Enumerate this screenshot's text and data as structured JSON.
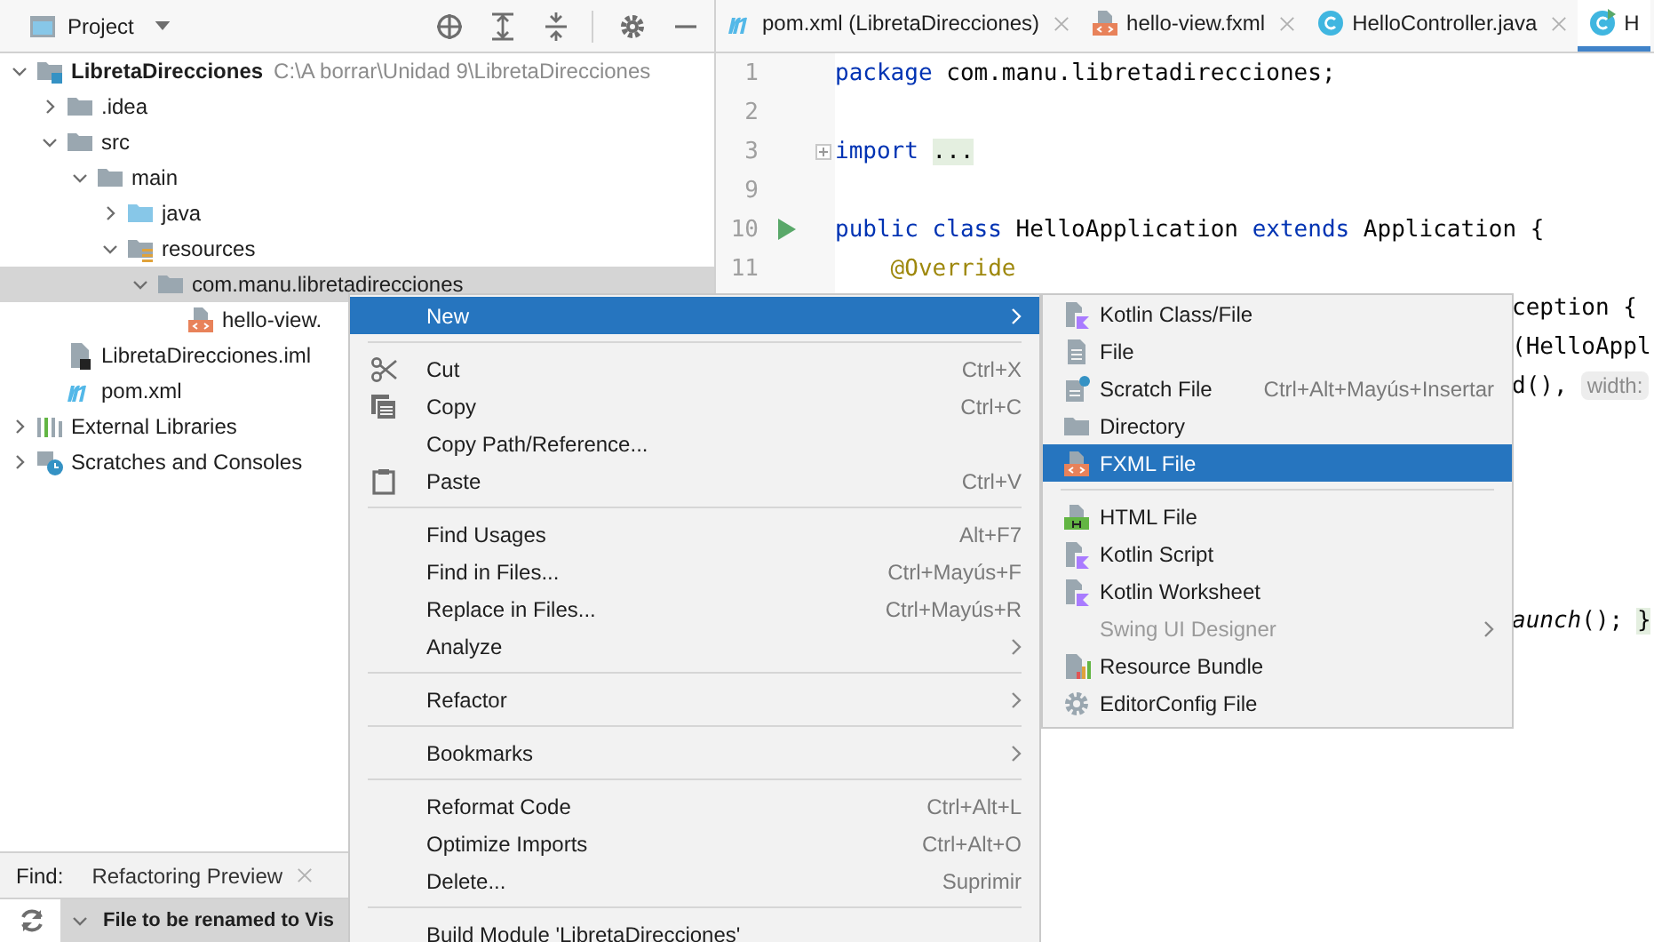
{
  "project_panel": {
    "title": "Project",
    "tree": [
      {
        "label": "LibretaDirecciones",
        "hint": "C:\\A borrar\\Unidad 9\\LibretaDirecciones",
        "kind": "module",
        "expanded": true,
        "selected": false,
        "children": [
          {
            "label": ".idea",
            "kind": "folder",
            "expanded": false,
            "selected": false
          },
          {
            "label": "src",
            "kind": "folder",
            "expanded": true,
            "selected": false,
            "children": [
              {
                "label": "main",
                "kind": "folder",
                "expanded": true,
                "selected": false,
                "children": [
                  {
                    "label": "java",
                    "kind": "source-folder",
                    "expanded": false,
                    "selected": false
                  },
                  {
                    "label": "resources",
                    "kind": "resources-folder",
                    "expanded": true,
                    "selected": false,
                    "children": [
                      {
                        "label": "com.manu.libretadirecciones",
                        "kind": "package",
                        "expanded": true,
                        "selected": true,
                        "children": [
                          {
                            "label": "hello-view.",
                            "kind": "fxml",
                            "selected": false
                          }
                        ]
                      }
                    ]
                  }
                ]
              }
            ]
          },
          {
            "label": "LibretaDirecciones.iml",
            "kind": "iml",
            "selected": false
          },
          {
            "label": "pom.xml",
            "kind": "maven",
            "selected": false
          }
        ]
      },
      {
        "label": "External Libraries",
        "kind": "libraries",
        "expanded": false,
        "selected": false
      },
      {
        "label": "Scratches and Consoles",
        "kind": "scratches",
        "expanded": false,
        "selected": false
      }
    ]
  },
  "find_panel": {
    "label": "Find:",
    "tab": "Refactoring Preview",
    "row": "File to be renamed to Vis"
  },
  "editor": {
    "tabs": [
      {
        "label": "pom.xml (LibretaDirecciones)",
        "kind": "maven",
        "selected": false
      },
      {
        "label": "hello-view.fxml",
        "kind": "fxml",
        "selected": false
      },
      {
        "label": "HelloController.java",
        "kind": "class",
        "selected": false
      },
      {
        "label": "H",
        "kind": "app-class",
        "selected": true
      }
    ],
    "lines": [
      {
        "number": "1",
        "tokens": [
          {
            "text": "package",
            "kind": "keyword"
          },
          {
            "text": " com.manu.libretadirecciones;",
            "kind": "plain"
          }
        ]
      },
      {
        "number": "2"
      },
      {
        "number": "3",
        "fold": true,
        "tokens": [
          {
            "text": "import",
            "kind": "keyword"
          },
          {
            "text": "...",
            "kind": "folded"
          }
        ]
      },
      {
        "number": "9"
      },
      {
        "number": "10",
        "run": true,
        "tokens": [
          {
            "text": "public class",
            "kind": "keyword"
          },
          {
            "text": " HelloApplication ",
            "kind": "plain"
          },
          {
            "text": "extends",
            "kind": "keyword"
          },
          {
            "text": " Application {",
            "kind": "plain"
          }
        ]
      },
      {
        "number": "11",
        "tokens": [
          {
            "text": "    @Override",
            "kind": "annotation"
          }
        ]
      }
    ],
    "fragments": [
      {
        "tokens": [
          {
            "text": "ception {",
            "kind": "plain"
          }
        ]
      },
      {
        "tokens": [
          {
            "text": "(HelloAppl",
            "kind": "plain"
          }
        ]
      },
      {
        "tokens": [
          {
            "text": "d(),",
            "kind": "plain"
          },
          {
            "text": "width:",
            "kind": "hint"
          }
        ]
      },
      {
        "tokens": [
          {
            "text": "aunch",
            "kind": "italic"
          },
          {
            "text": "(); ",
            "kind": "plain"
          },
          {
            "text": "}",
            "kind": "folded"
          }
        ]
      }
    ]
  },
  "context_menu": {
    "items": [
      {
        "kind": "action",
        "label": "New",
        "submenu": true,
        "selected": true
      },
      {
        "kind": "separator"
      },
      {
        "kind": "action",
        "label": "Cut",
        "shortcut": "Ctrl+X",
        "selected": false
      },
      {
        "kind": "action",
        "label": "Copy",
        "shortcut": "Ctrl+C",
        "selected": false
      },
      {
        "kind": "action",
        "label": "Copy Path/Reference...",
        "selected": false
      },
      {
        "kind": "action",
        "label": "Paste",
        "shortcut": "Ctrl+V",
        "selected": false
      },
      {
        "kind": "separator"
      },
      {
        "kind": "action",
        "label": "Find Usages",
        "shortcut": "Alt+F7",
        "selected": false
      },
      {
        "kind": "action",
        "label": "Find in Files...",
        "shortcut": "Ctrl+Mayús+F",
        "selected": false
      },
      {
        "kind": "action",
        "label": "Replace in Files...",
        "shortcut": "Ctrl+Mayús+R",
        "selected": false
      },
      {
        "kind": "action",
        "label": "Analyze",
        "submenu": true,
        "selected": false
      },
      {
        "kind": "separator"
      },
      {
        "kind": "action",
        "label": "Refactor",
        "submenu": true,
        "selected": false
      },
      {
        "kind": "separator"
      },
      {
        "kind": "action",
        "label": "Bookmarks",
        "submenu": true,
        "selected": false
      },
      {
        "kind": "separator"
      },
      {
        "kind": "action",
        "label": "Reformat Code",
        "shortcut": "Ctrl+Alt+L",
        "selected": false
      },
      {
        "kind": "action",
        "label": "Optimize Imports",
        "shortcut": "Ctrl+Alt+O",
        "selected": false
      },
      {
        "kind": "action",
        "label": "Delete...",
        "shortcut": "Suprimir",
        "selected": false
      },
      {
        "kind": "separator"
      },
      {
        "kind": "action",
        "label": "Build Module 'LibretaDirecciones'",
        "selected": false
      }
    ]
  },
  "new_submenu": {
    "items": [
      {
        "kind": "action",
        "label": "Kotlin Class/File",
        "selected": false,
        "disabled": false
      },
      {
        "kind": "action",
        "label": "File",
        "selected": false,
        "disabled": false
      },
      {
        "kind": "action",
        "label": "Scratch File",
        "shortcut": "Ctrl+Alt+Mayús+Insertar",
        "selected": false,
        "disabled": false
      },
      {
        "kind": "action",
        "label": "Directory",
        "selected": false,
        "disabled": false
      },
      {
        "kind": "action",
        "label": "FXML File",
        "selected": true,
        "disabled": false
      },
      {
        "kind": "separator"
      },
      {
        "kind": "action",
        "label": "HTML File",
        "selected": false,
        "disabled": false
      },
      {
        "kind": "action",
        "label": "Kotlin Script",
        "selected": false,
        "disabled": false
      },
      {
        "kind": "action",
        "label": "Kotlin Worksheet",
        "selected": false,
        "disabled": false
      },
      {
        "kind": "action",
        "label": "Swing UI Designer",
        "submenu": true,
        "selected": false,
        "disabled": true
      },
      {
        "kind": "action",
        "label": "Resource Bundle",
        "selected": false,
        "disabled": false
      },
      {
        "kind": "action",
        "label": "EditorConfig File",
        "selected": false,
        "disabled": false
      }
    ]
  }
}
